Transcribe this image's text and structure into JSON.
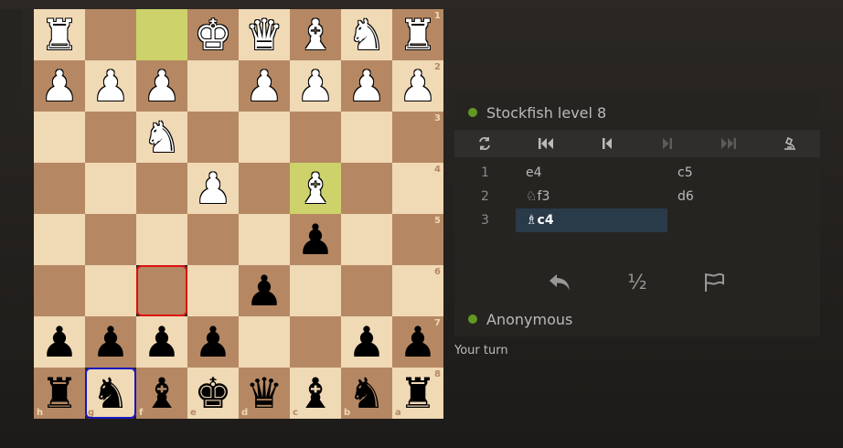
{
  "board": {
    "files": [
      "h",
      "g",
      "f",
      "e",
      "d",
      "c",
      "b",
      "a"
    ],
    "ranks": [
      "1",
      "2",
      "3",
      "4",
      "5",
      "6",
      "7",
      "8"
    ],
    "squares": [
      [
        "wR",
        "",
        "",
        "wK",
        "wQ",
        "wB",
        "wN",
        "wR"
      ],
      [
        "wP",
        "wP",
        "wP",
        "",
        "wP",
        "wP",
        "wP",
        "wP"
      ],
      [
        "",
        "",
        "wN",
        "",
        "",
        "",
        "",
        ""
      ],
      [
        "",
        "",
        "",
        "wP",
        "",
        "wB",
        "",
        ""
      ],
      [
        "",
        "",
        "",
        "",
        "",
        "bP",
        "",
        ""
      ],
      [
        "",
        "",
        "",
        "",
        "bP",
        "",
        "",
        ""
      ],
      [
        "bP",
        "bP",
        "bP",
        "bP",
        "",
        "",
        "bP",
        "bP"
      ],
      [
        "bR",
        "bN",
        "bB",
        "bK",
        "bQ",
        "bB",
        "bN",
        "bR"
      ]
    ],
    "highlights": [
      [
        0,
        2
      ],
      [
        3,
        5
      ]
    ],
    "selected_red": [
      5,
      2
    ],
    "selected_blue": [
      7,
      1
    ]
  },
  "opponent": {
    "name": "Stockfish level 8"
  },
  "player": {
    "name": "Anonymous"
  },
  "tools": {
    "flip_icon": "flip-board-icon",
    "first_icon": "first-move-icon",
    "prev_icon": "prev-move-icon",
    "next_icon": "next-move-icon",
    "last_icon": "last-move-icon",
    "analysis_icon": "microscope-icon"
  },
  "moves": [
    {
      "num": "1",
      "white": "e4",
      "black": "c5"
    },
    {
      "num": "2",
      "white": "♘f3",
      "black": "d6"
    },
    {
      "num": "3",
      "white": "♗c4",
      "black": ""
    }
  ],
  "controls": {
    "takeback_icon": "takeback-icon",
    "draw_label": "½",
    "resign_icon": "flag-icon"
  },
  "status": {
    "turn": "Your turn"
  },
  "colors": {
    "light": "#f0d9b5",
    "dark": "#b58863",
    "highlight": "#cdd26a",
    "online": "#629924",
    "active_move": "#293a49"
  }
}
